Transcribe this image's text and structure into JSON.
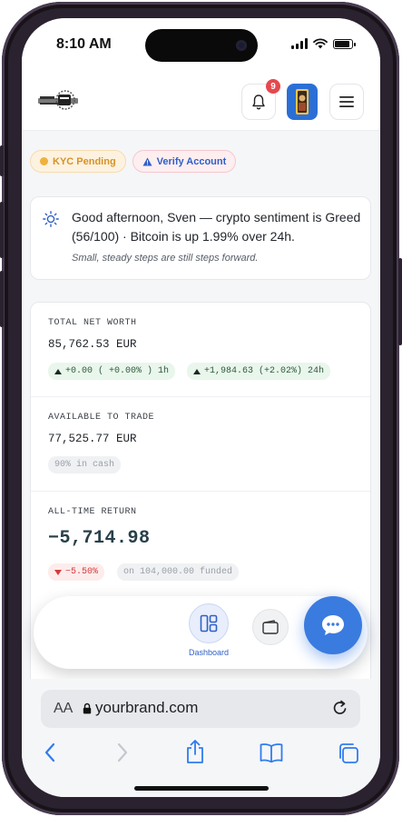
{
  "status_bar": {
    "time": "8:10 AM"
  },
  "header": {
    "notifications_count": "9"
  },
  "chips": {
    "kyc": "KYC Pending",
    "verify": "Verify Account"
  },
  "greeting": {
    "message": "Good afternoon, Sven — crypto sentiment is Greed (56/100) · Bitcoin is up 1.99% over 24h.",
    "subtitle": "Small, steady steps are still steps forward."
  },
  "net_worth": {
    "label": "TOTAL NET WORTH",
    "value": "85,762.53 EUR",
    "change_1h": "+0.00 ( +0.00% ) 1h",
    "change_24h": "+1,984.63 (+2.02%) 24h"
  },
  "available": {
    "label": "AVAILABLE TO TRADE",
    "value": "77,525.77 EUR",
    "cash_pct": "90% in cash"
  },
  "all_time": {
    "label": "ALL-TIME RETURN",
    "value": "−5,714.98",
    "pct": "−5.50%",
    "funded": "on 104,000.00 funded"
  },
  "nav": {
    "dashboard_label": "Dashboard"
  },
  "browser": {
    "aa": "AA",
    "url": "yourbrand.com"
  },
  "colors": {
    "accent": "#3a7be0",
    "badge": "#e5484d",
    "kyc": "#d69327",
    "negative": "#d23b3b"
  },
  "icons": [
    "bell-icon",
    "menu-icon",
    "sun-icon",
    "dashboard-icon",
    "wallet-icon",
    "chat-icon",
    "lock-icon",
    "reload-icon",
    "back-icon",
    "forward-icon",
    "share-icon",
    "bookmarks-icon",
    "tabs-icon"
  ]
}
